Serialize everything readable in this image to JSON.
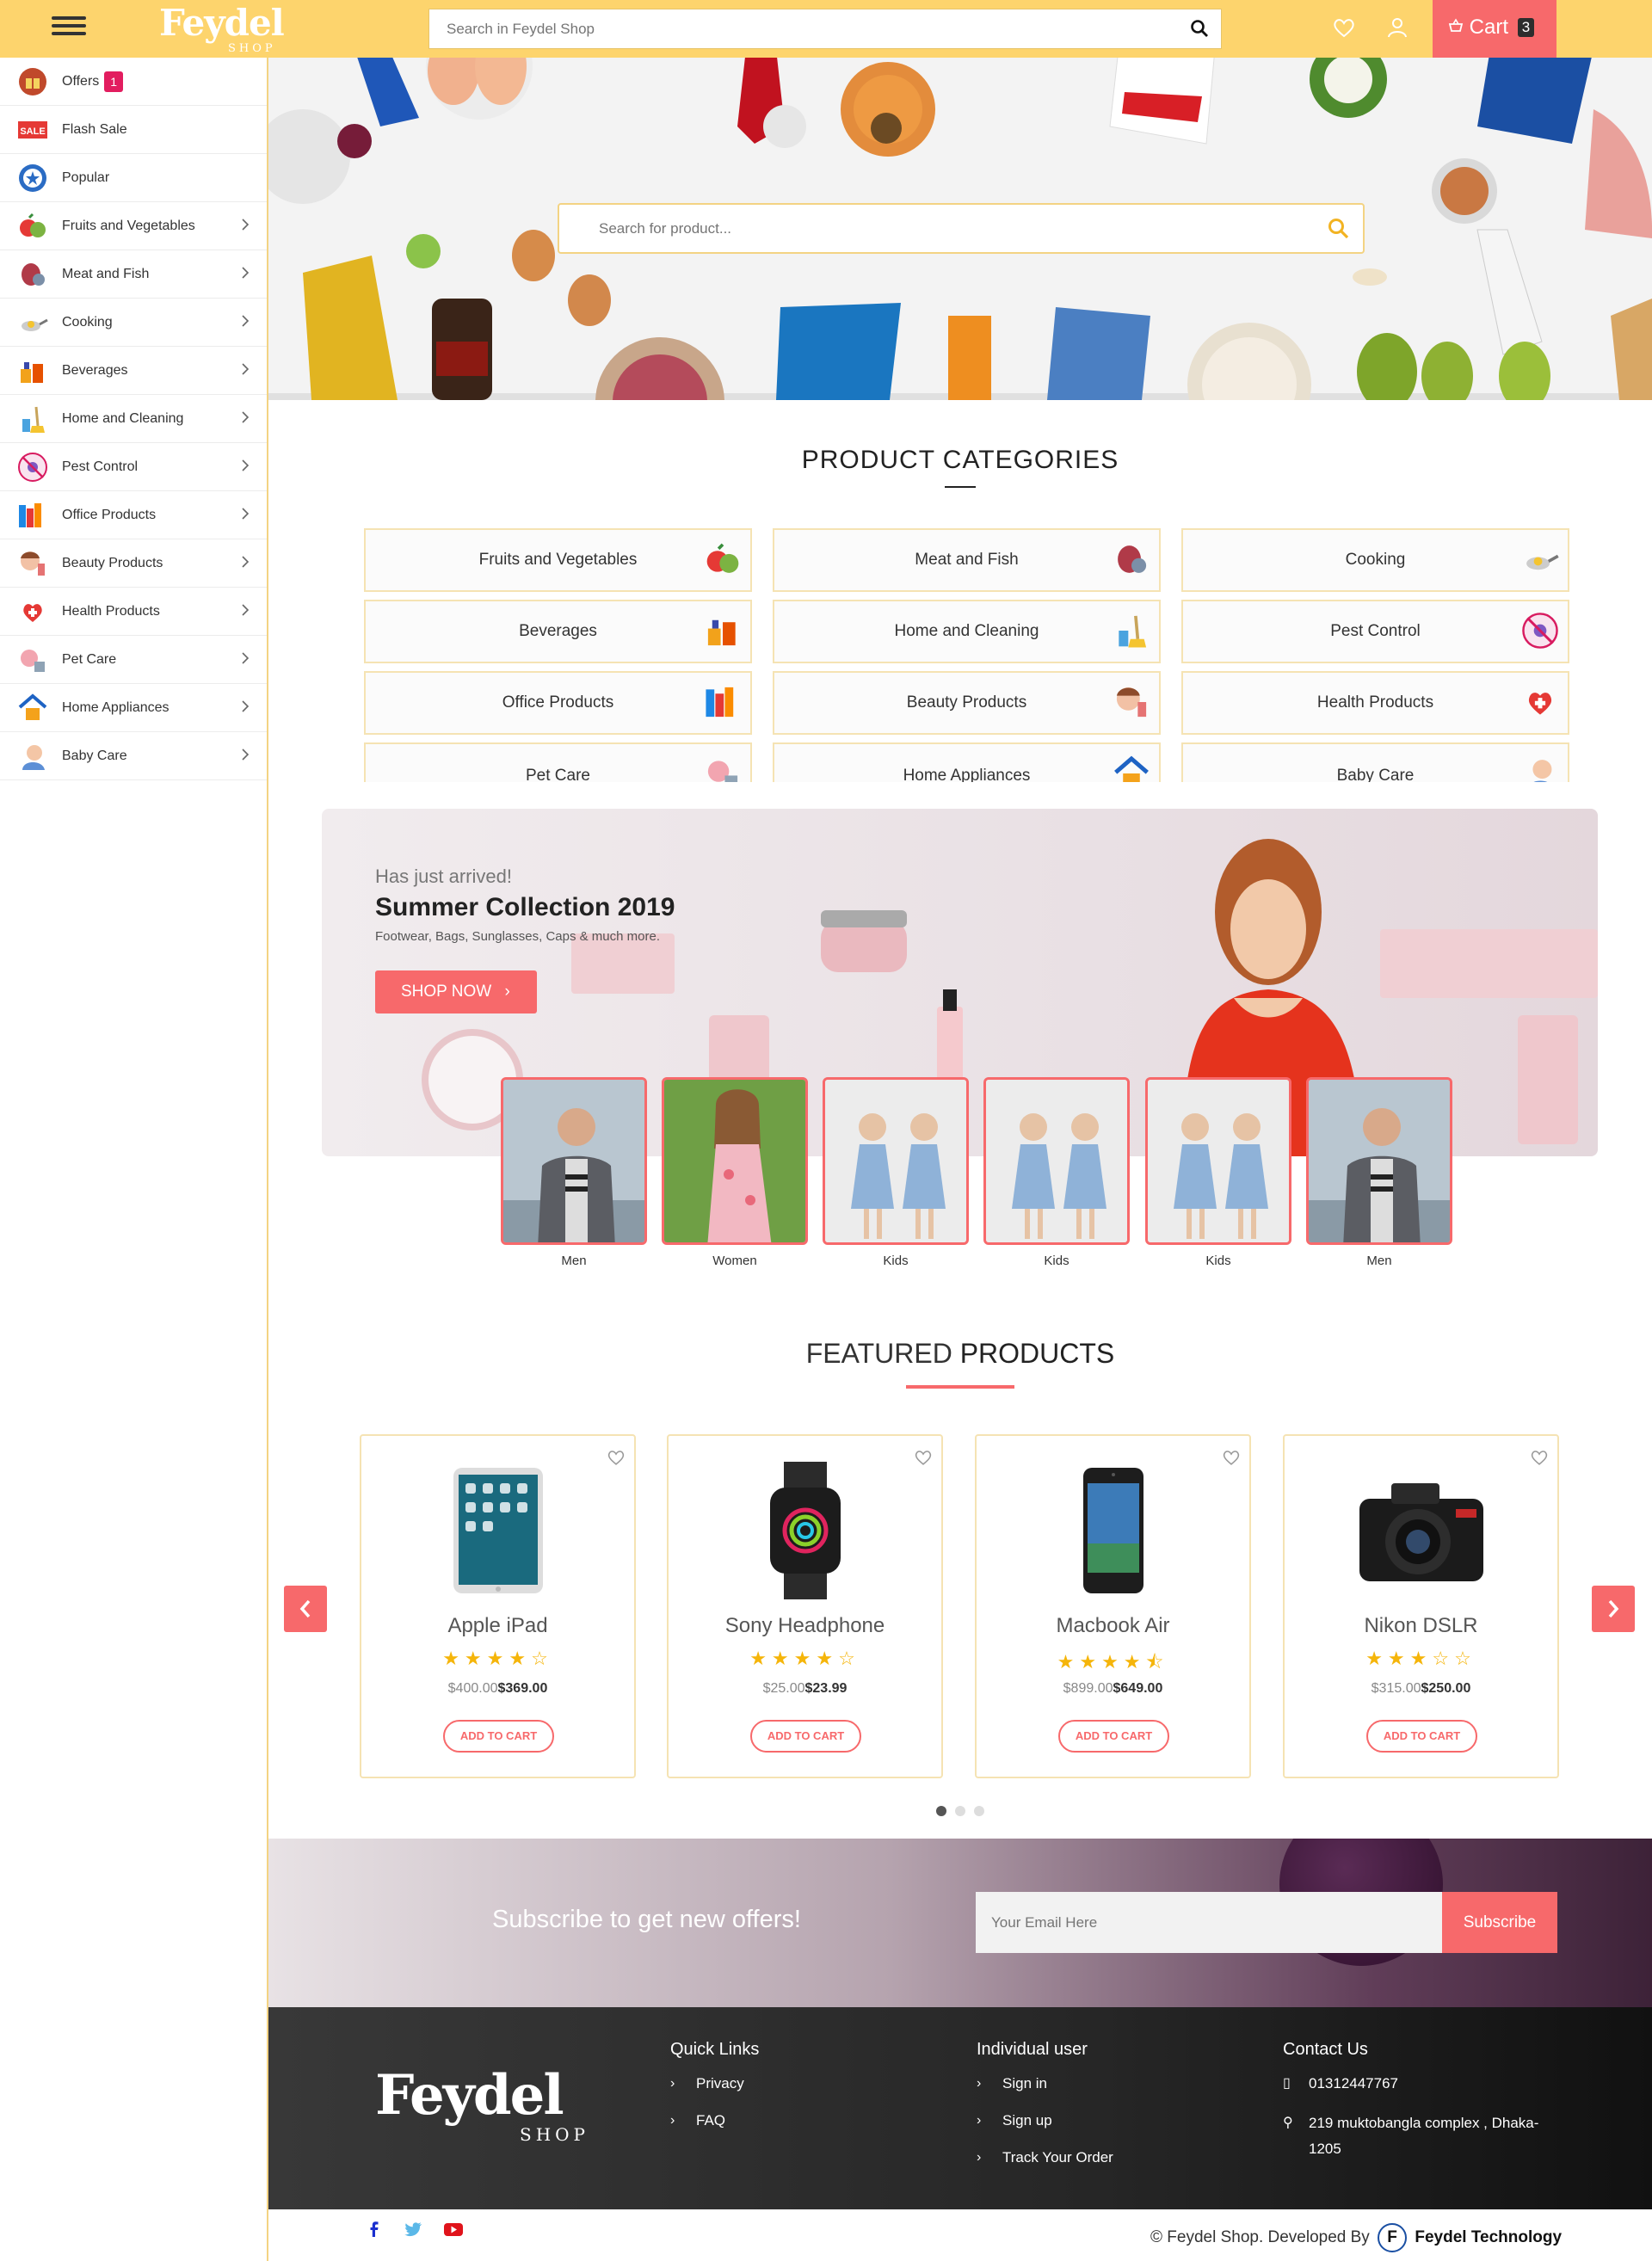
{
  "header": {
    "logo_main": "Feydel",
    "logo_sub": "SHOP",
    "search_placeholder": "Search in Feydel Shop",
    "cart_label": "Cart",
    "cart_count": "3"
  },
  "sidebar": {
    "items": [
      {
        "label": "Offers",
        "icon": "gift-icon",
        "badge": "1"
      },
      {
        "label": "Flash Sale",
        "icon": "sale-tag-icon"
      },
      {
        "label": "Popular",
        "icon": "star-badge-icon"
      },
      {
        "label": "Fruits and Vegetables",
        "icon": "fruits-icon"
      },
      {
        "label": "Meat and Fish",
        "icon": "meat-icon"
      },
      {
        "label": "Cooking",
        "icon": "cooking-pan-icon"
      },
      {
        "label": "Beverages",
        "icon": "beverages-icon"
      },
      {
        "label": "Home and Cleaning",
        "icon": "cleaning-icon"
      },
      {
        "label": "Pest Control",
        "icon": "pest-control-icon"
      },
      {
        "label": "Office Products",
        "icon": "office-books-icon"
      },
      {
        "label": "Beauty Products",
        "icon": "beauty-icon"
      },
      {
        "label": "Health Products",
        "icon": "health-icon"
      },
      {
        "label": "Pet Care",
        "icon": "pet-icon"
      },
      {
        "label": "Home Appliances",
        "icon": "home-appliance-icon"
      },
      {
        "label": "Baby Care",
        "icon": "baby-icon"
      }
    ]
  },
  "hero": {
    "search_placeholder": "Search for product..."
  },
  "categories": {
    "title": "PRODUCT CATEGORIES",
    "items": [
      "Fruits and Vegetables",
      "Meat and Fish",
      "Cooking",
      "Beverages",
      "Home and Cleaning",
      "Pest Control",
      "Office Products",
      "Beauty Products",
      "Health Products",
      "Pet Care",
      "Home Appliances",
      "Baby Care"
    ]
  },
  "promo": {
    "kicker": "Has just arrived!",
    "title": "Summer Collection 2019",
    "subtitle": "Footwear, Bags, Sunglasses, Caps & much more.",
    "cta": "SHOP NOW",
    "thumbs": [
      "Men",
      "Women",
      "Kids",
      "Kids",
      "Kids",
      "Men"
    ]
  },
  "featured": {
    "title_light": "FEATURED",
    "title_bold": "PRODUCTS",
    "products": [
      {
        "name": "Apple iPad",
        "rating": 4,
        "old_price": "$400.00",
        "new_price": "$369.00",
        "cta": "ADD TO CART"
      },
      {
        "name": "Sony Headphone",
        "rating": 4,
        "old_price": "$25.00",
        "new_price": "$23.99",
        "cta": "ADD TO CART"
      },
      {
        "name": "Macbook Air",
        "rating": 4.5,
        "old_price": "$899.00",
        "new_price": "$649.00",
        "cta": "ADD TO CART"
      },
      {
        "name": "Nikon DSLR",
        "rating": 3,
        "old_price": "$315.00",
        "new_price": "$250.00",
        "cta": "ADD TO CART"
      }
    ],
    "active_dot": 0
  },
  "subscribe": {
    "text": "Subscribe to get new offers!",
    "placeholder": "Your Email Here",
    "button": "Subscribe"
  },
  "footer": {
    "quick_links": {
      "title": "Quick Links",
      "items": [
        "Privacy",
        "FAQ"
      ]
    },
    "individual": {
      "title": "Individual user",
      "items": [
        "Sign in",
        "Sign up",
        "Track Your Order"
      ]
    },
    "contact": {
      "title": "Contact Us",
      "phone": "01312447767",
      "address": "219 muktobangla complex , Dhaka-1205"
    },
    "copyright": "© Feydel Shop. Developed By",
    "developer": "Feydel Technology"
  },
  "colors": {
    "topbar": "#fdd46d",
    "accent": "#f7696b",
    "badge": "#e21d5f",
    "star": "#f5b50a"
  }
}
